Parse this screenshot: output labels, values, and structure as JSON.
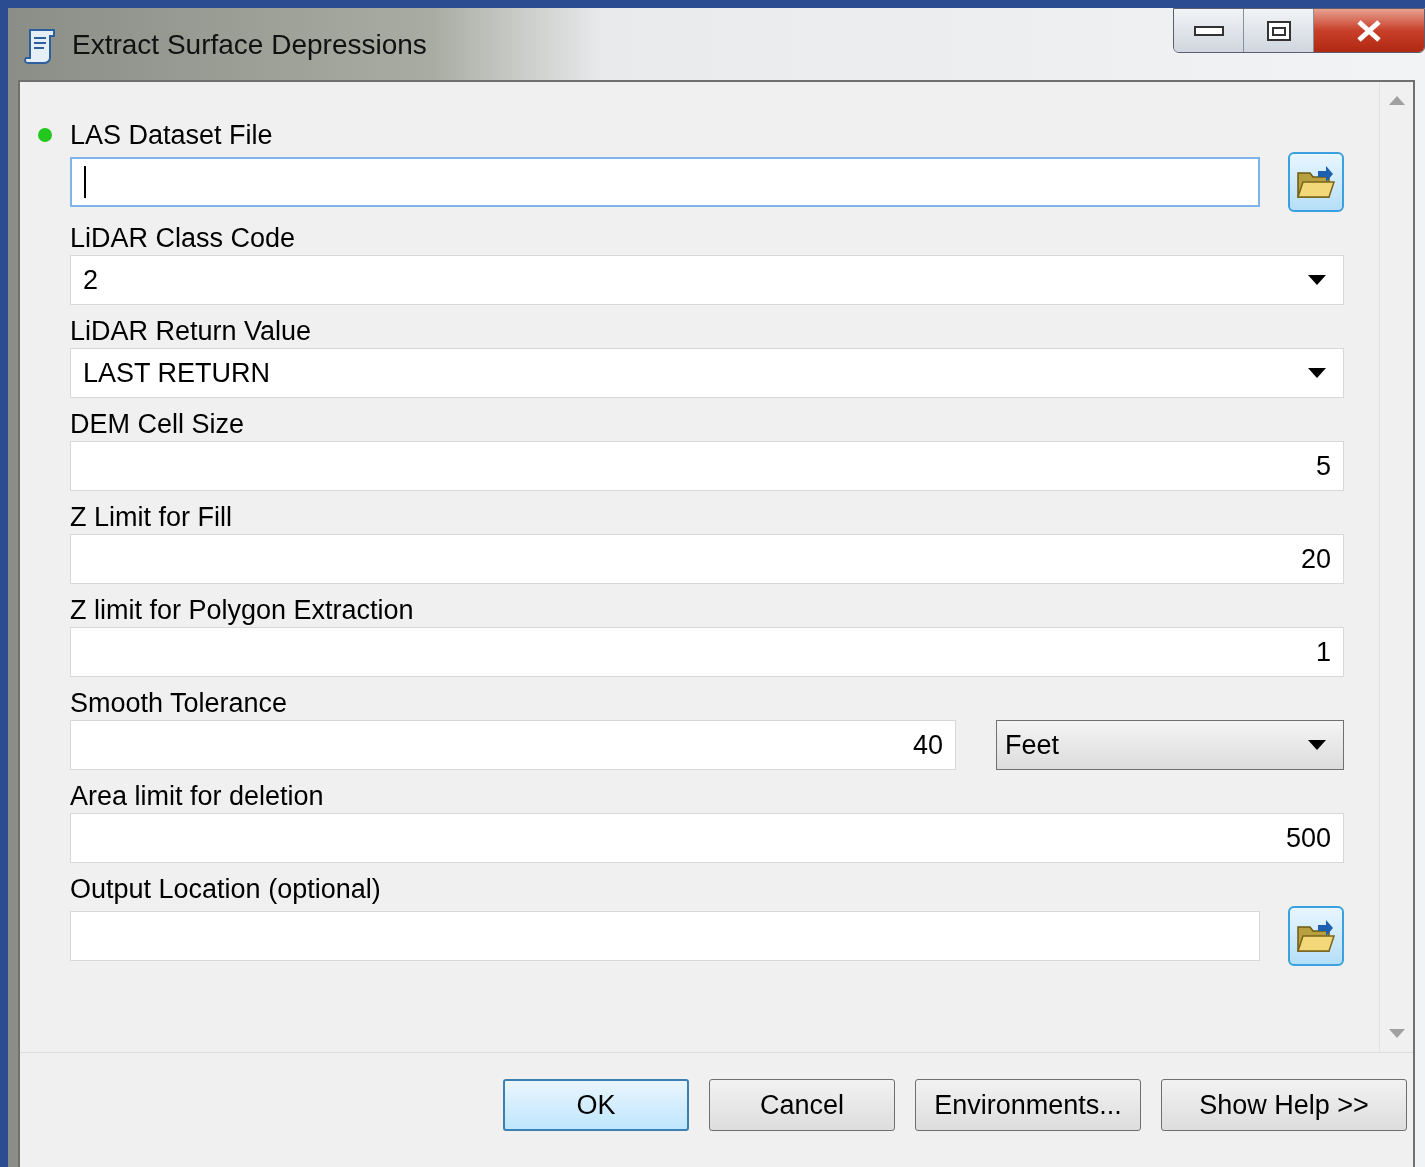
{
  "window": {
    "title": "Extract Surface Depressions"
  },
  "parameters": [
    {
      "label": "LAS Dataset File",
      "kind": "file",
      "required": true,
      "focused": true
    },
    {
      "label": "LiDAR Class Code",
      "kind": "dropdown",
      "value": "2",
      "required": false,
      "focused": false
    },
    {
      "label": "LiDAR Return Value",
      "kind": "dropdown",
      "value": "LAST RETURN",
      "required": false,
      "focused": false
    },
    {
      "label": "DEM Cell Size",
      "kind": "number",
      "value": "5",
      "required": false,
      "focused": false
    },
    {
      "label": "Z Limit for Fill",
      "kind": "number",
      "value": "20",
      "required": false,
      "focused": false
    },
    {
      "label": "Z limit for Polygon Extraction",
      "kind": "number",
      "value": "1",
      "required": false,
      "focused": false
    },
    {
      "label": "Smooth Tolerance",
      "kind": "number_unit",
      "value": "40",
      "unit": "Feet",
      "required": false,
      "focused": false
    },
    {
      "label": "Area limit for deletion",
      "kind": "number",
      "value": "500",
      "required": false,
      "focused": false
    },
    {
      "label": "Output Location (optional)",
      "kind": "file",
      "required": false,
      "focused": false
    }
  ],
  "buttons": [
    {
      "label": "OK",
      "selected": true
    },
    {
      "label": "Cancel",
      "selected": false
    },
    {
      "label": "Environments...",
      "selected": false
    },
    {
      "label": "Show Help >>",
      "selected": false
    }
  ]
}
